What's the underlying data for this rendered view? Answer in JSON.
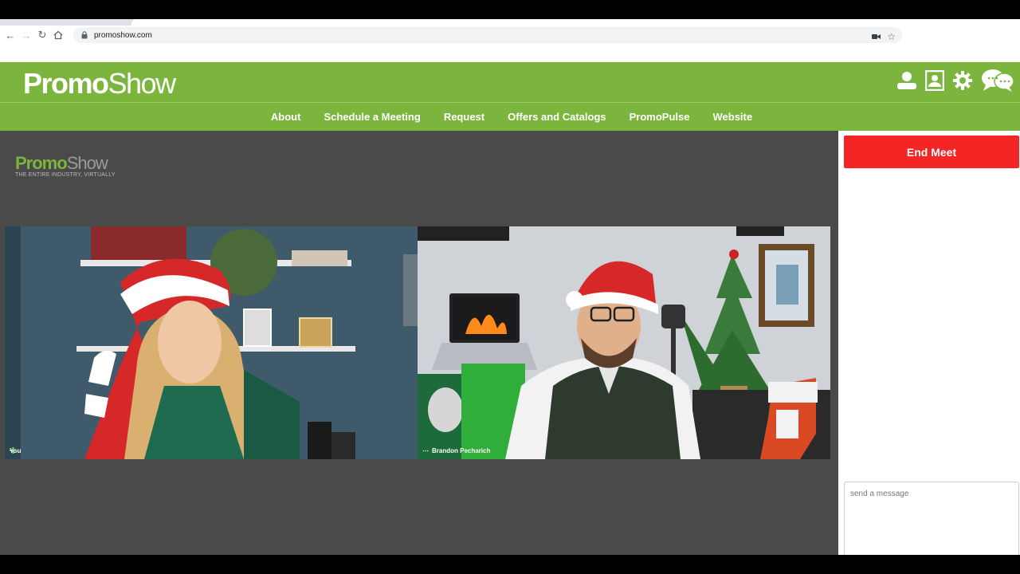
{
  "browser": {
    "url": "promoshow.com"
  },
  "header": {
    "logo_bold": "Promo",
    "logo_thin": "Show",
    "icons": [
      "user-icon",
      "profile-card-icon",
      "gear-icon",
      "chat-bubbles-icon"
    ]
  },
  "nav": {
    "items": [
      {
        "label": "About"
      },
      {
        "label": "Schedule a Meeting"
      },
      {
        "label": "Request"
      },
      {
        "label": "Offers and Catalogs"
      },
      {
        "label": "PromoPulse"
      },
      {
        "label": "Website"
      }
    ]
  },
  "watermark": {
    "brand_bold": "Promo",
    "brand_thin": "Show",
    "tagline": "THE ENTIRE INDUSTRY, VIRTUALLY"
  },
  "videos": [
    {
      "name": "You"
    },
    {
      "name": "Brandon Pecharich"
    }
  ],
  "sidebar": {
    "end_button": "End Meet",
    "message_placeholder": "send a message"
  },
  "colors": {
    "brand_green": "#7cb53d",
    "end_red": "#f42525",
    "stage_gray": "#4a4a4a"
  }
}
